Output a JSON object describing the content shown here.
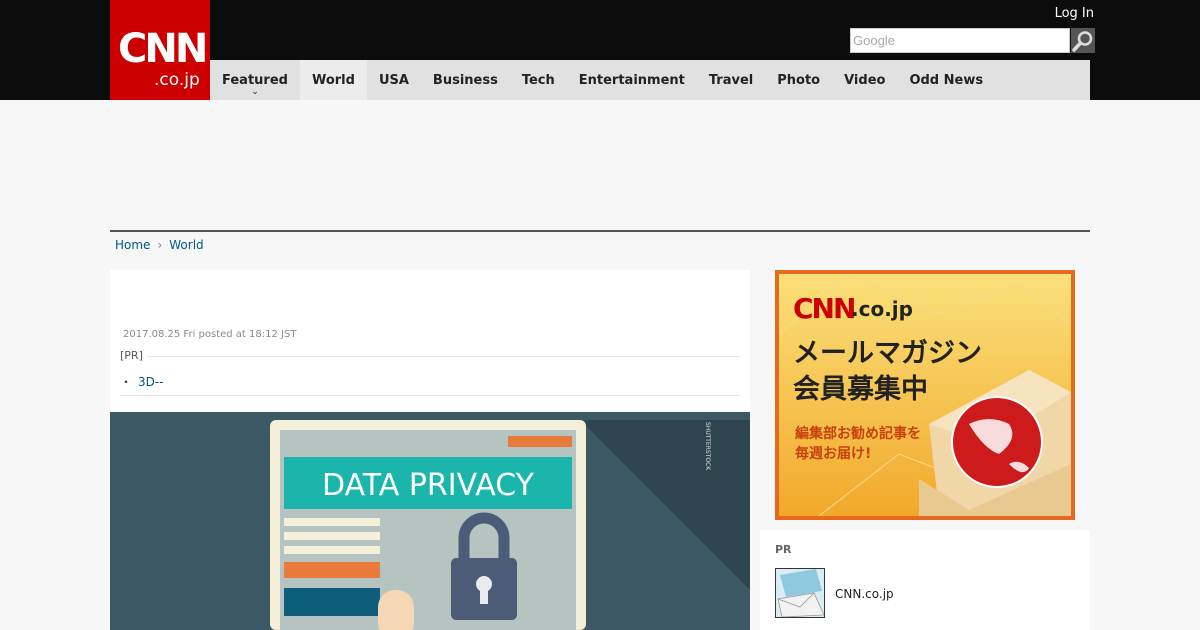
{
  "header": {
    "logo_main": "CNN",
    "logo_sub": ".co.jp",
    "login_label": "Log In",
    "search_placeholder": "Google"
  },
  "nav": {
    "items": [
      {
        "label": "Featured"
      },
      {
        "label": "World"
      },
      {
        "label": "USA"
      },
      {
        "label": "Business"
      },
      {
        "label": "Tech"
      },
      {
        "label": "Entertainment"
      },
      {
        "label": "Travel"
      },
      {
        "label": "Photo"
      },
      {
        "label": "Video"
      },
      {
        "label": "Odd News"
      }
    ]
  },
  "breadcrumb": {
    "home": "Home",
    "separator": "›",
    "current": "World"
  },
  "article": {
    "date": "2017.08.25 Fri posted at 18:12 JST",
    "pr_label": "[PR]",
    "pr_bullet": "・",
    "pr_link": "3D--",
    "hero_text": "DATA PRIVACY",
    "hero_credit": "SHUTTERSTOCK"
  },
  "sidebar_ad": {
    "brand": "CNN",
    "brand_sub": ".co.jp",
    "headline_1": "メールマガジン",
    "headline_2": "会員募集中",
    "sub_1": "編集部お勧め記事を",
    "sub_2": "毎週お届け!"
  },
  "pr_panel": {
    "title": "PR",
    "item_name": "CNN.co.jp"
  },
  "colors": {
    "brand_red": "#cc0000",
    "link_blue": "#005689",
    "nav_bg": "#e1e1e1",
    "ad_orange": "#f3a41b"
  }
}
